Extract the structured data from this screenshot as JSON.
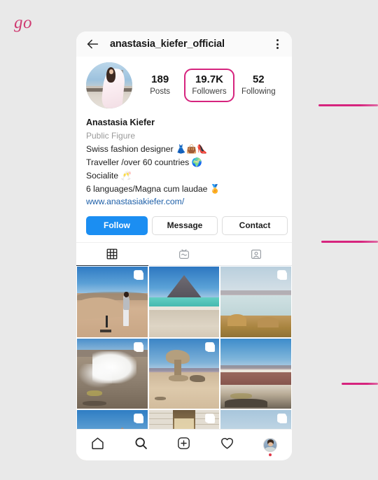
{
  "annotation": {
    "go_label": "go",
    "accent_color": "#d6247e",
    "rules": [
      "rule-1",
      "rule-2",
      "rule-3"
    ]
  },
  "topbar": {
    "back_icon": "back-arrow-icon",
    "title": "anastasia_kiefer_official",
    "menu_icon": "kebab-menu-icon"
  },
  "profile": {
    "avatar_alt": "profile-avatar",
    "display_name": "Anastasia Kiefer",
    "category": "Public Figure",
    "bio_lines": [
      "Swiss fashion designer 👗👜👠",
      "Traveller /over 60 countries 🌍",
      "Socialite 🥂",
      "6 languages/Magna cum laudae 🏅"
    ],
    "website": "www.anastasiakiefer.com/"
  },
  "stats": [
    {
      "num": "189",
      "label": "Posts",
      "highlighted": false
    },
    {
      "num": "19.7K",
      "label": "Followers",
      "highlighted": true
    },
    {
      "num": "52",
      "label": "Following",
      "highlighted": false
    }
  ],
  "actions": {
    "follow_label": "Follow",
    "message_label": "Message",
    "contact_label": "Contact",
    "more_icon": "chevron-down-icon"
  },
  "tabs": [
    {
      "name": "grid-tab",
      "icon": "grid-icon",
      "active": true
    },
    {
      "name": "igtv-tab",
      "icon": "igtv-icon",
      "active": false
    },
    {
      "name": "tagged-tab",
      "icon": "tagged-person-icon",
      "active": false
    }
  ],
  "grid": [
    {
      "scene": "desert-dune-woman",
      "multi": true
    },
    {
      "scene": "green-lagoon-volcano",
      "multi": false
    },
    {
      "scene": "pale-salt-lagoon",
      "multi": true
    },
    {
      "scene": "geyser-steam",
      "multi": true
    },
    {
      "scene": "stone-tree-rock",
      "multi": true
    },
    {
      "scene": "red-lagoon",
      "multi": false
    },
    {
      "scene": "andes-mountain",
      "multi": true
    },
    {
      "scene": "stone-corridor",
      "multi": true
    },
    {
      "scene": "salt-flat-woman",
      "multi": true
    }
  ],
  "bottomnav": [
    {
      "name": "home-nav-icon",
      "icon": "home-icon"
    },
    {
      "name": "search-nav-icon",
      "icon": "search-icon"
    },
    {
      "name": "add-post-nav-icon",
      "icon": "plus-square-icon"
    },
    {
      "name": "activity-nav-icon",
      "icon": "heart-icon"
    },
    {
      "name": "profile-nav-avatar",
      "icon": "avatar-icon"
    }
  ]
}
